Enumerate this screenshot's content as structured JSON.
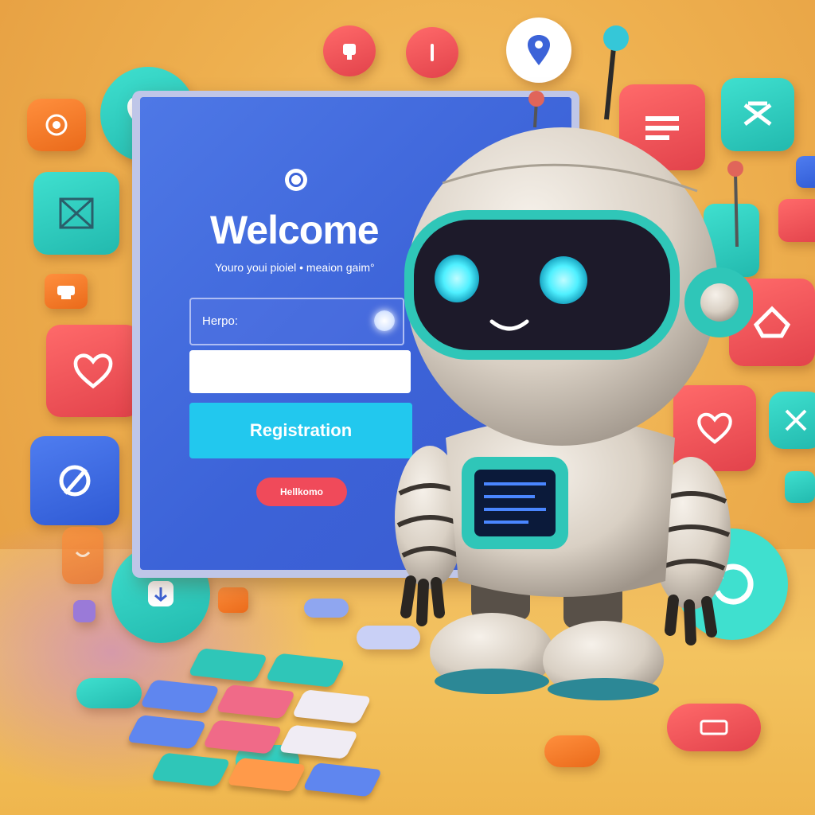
{
  "login_card": {
    "title": "Welcome",
    "subtitle": "Youro youi pioiel • meaion gaim°",
    "username_placeholder": "Herpo:",
    "password_value": "",
    "register_label": "Registration",
    "secondary_label": "Hellkomo"
  },
  "colors": {
    "background": "#eeb04f",
    "screen": "#3c63d8",
    "register_button": "#22c8ee",
    "secondary_button": "#f04a5a",
    "robot_visor": "#1d1a2a",
    "robot_eyes": "#4ff0ff",
    "accent_teal": "#2fc6b8"
  },
  "icons": [
    "heart-icon",
    "target-icon",
    "image-icon",
    "printer-icon",
    "location-pin-icon",
    "trophy-icon",
    "info-icon",
    "list-icon",
    "tools-icon",
    "pencil-icon",
    "chat-icon",
    "share-icon",
    "map-icon",
    "refresh-icon"
  ]
}
